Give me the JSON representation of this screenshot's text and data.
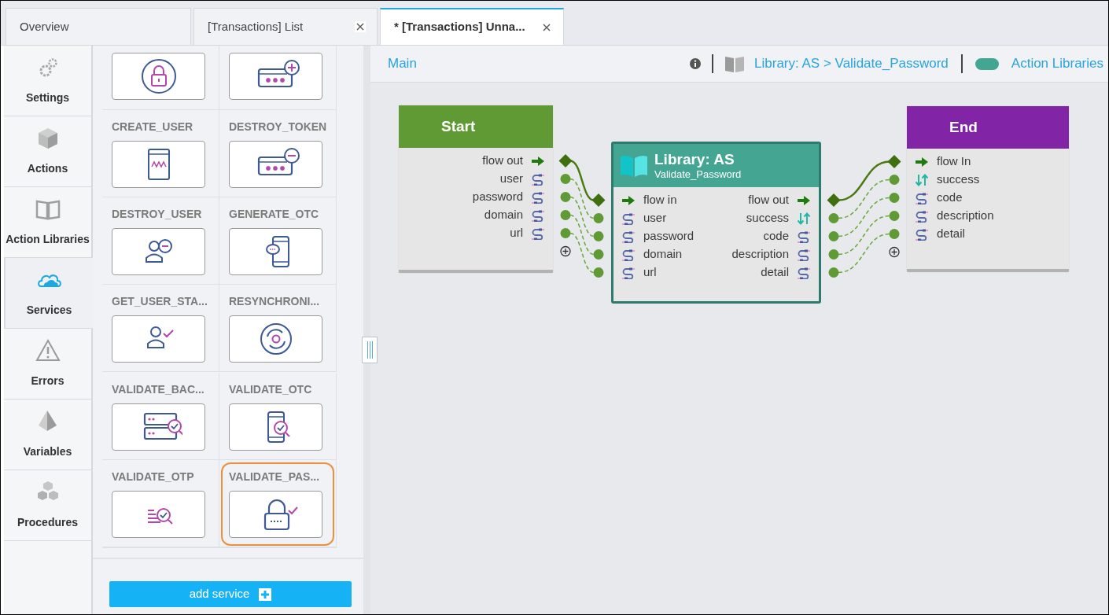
{
  "tabs": [
    {
      "label": "Overview",
      "selected": false,
      "closable": false
    },
    {
      "label": "[Transactions] List",
      "selected": false,
      "closable": true
    },
    {
      "label": "* [Transactions] Unna...",
      "selected": true,
      "closable": true
    }
  ],
  "sidebar": {
    "items": [
      {
        "label": "Settings",
        "kind": "gears",
        "selected": false
      },
      {
        "label": "Actions",
        "kind": "cube",
        "selected": false
      },
      {
        "label": "Action Libraries",
        "kind": "book",
        "selected": false
      },
      {
        "label": "Services",
        "kind": "cloud",
        "selected": true
      },
      {
        "label": "Errors",
        "kind": "warning",
        "selected": false
      },
      {
        "label": "Variables",
        "kind": "pyramid",
        "selected": false
      },
      {
        "label": "Procedures",
        "kind": "cubes",
        "selected": false
      }
    ]
  },
  "services": {
    "tiles": [
      {
        "kind": "lock",
        "selected": false
      },
      {
        "kind": "key_add",
        "selected": false
      },
      {
        "label": "CREATE_USER",
        "kind": "https",
        "selected": false
      },
      {
        "label": "DESTROY_TOKEN",
        "kind": "key_remove",
        "selected": false
      },
      {
        "label": "DESTROY_USER",
        "kind": "user_remove",
        "selected": false
      },
      {
        "label": "GENERATE_OTC",
        "kind": "phone_chat",
        "selected": false
      },
      {
        "label": "GET_USER_STA...",
        "kind": "user_check",
        "selected": false
      },
      {
        "label": "RESYNCHRONI...",
        "kind": "sync",
        "selected": false
      },
      {
        "label": "VALIDATE_BAC...",
        "kind": "server_search",
        "selected": false
      },
      {
        "label": "VALIDATE_OTC",
        "kind": "phone_search",
        "selected": false
      },
      {
        "label": "VALIDATE_OTP",
        "kind": "list_search",
        "selected": false
      },
      {
        "label": "VALIDATE_PAS...",
        "kind": "lock_check",
        "selected": true
      }
    ],
    "add_button": "add service"
  },
  "canvas": {
    "breadcrumb": "Main",
    "path": "Library: AS > Validate_Password",
    "libraries_link": "Action Libraries",
    "libraries_toggle_on": true,
    "nodes": [
      {
        "kind": "start",
        "title": "Start",
        "outputs": [
          {
            "label": "flow out",
            "kind": "flow",
            "connected": true
          },
          {
            "label": "user",
            "kind": "data",
            "connected": true
          },
          {
            "label": "password",
            "kind": "data",
            "connected": true
          },
          {
            "label": "domain",
            "kind": "data",
            "connected": true
          },
          {
            "label": "url",
            "kind": "data",
            "connected": true
          }
        ]
      },
      {
        "kind": "library",
        "title": "Library: AS",
        "subtitle": "Validate_Password",
        "inputs": [
          {
            "label": "flow in",
            "kind": "flow"
          },
          {
            "label": "user",
            "kind": "data"
          },
          {
            "label": "password",
            "kind": "data"
          },
          {
            "label": "domain",
            "kind": "data"
          },
          {
            "label": "url",
            "kind": "data"
          }
        ],
        "outputs": [
          {
            "label": "flow out",
            "kind": "flow",
            "connected": true
          },
          {
            "label": "success",
            "kind": "boolean",
            "connected": true
          },
          {
            "label": "code",
            "kind": "data",
            "connected": true
          },
          {
            "label": "description",
            "kind": "data",
            "connected": true
          },
          {
            "label": "detail",
            "kind": "data",
            "connected": true
          }
        ]
      },
      {
        "kind": "end",
        "title": "End",
        "inputs": [
          {
            "label": "flow In",
            "kind": "flow"
          },
          {
            "label": "success",
            "kind": "boolean"
          },
          {
            "label": "code",
            "kind": "data"
          },
          {
            "label": "description",
            "kind": "data"
          },
          {
            "label": "detail",
            "kind": "data"
          }
        ]
      }
    ]
  }
}
